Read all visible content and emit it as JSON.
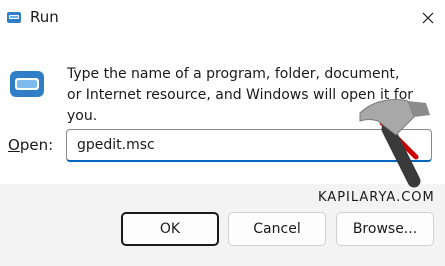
{
  "window": {
    "title": "Run",
    "icon": "run-app-icon",
    "close_icon": "close-icon"
  },
  "main": {
    "description": "Type the name of a program, folder, document, or Internet resource, and Windows will open it for you.",
    "open_label_mnemonic": "O",
    "open_label_rest": "pen:",
    "open_value": "gpedit.msc"
  },
  "buttons": {
    "ok": "OK",
    "cancel": "Cancel",
    "browse": "Browse..."
  },
  "watermark": {
    "text": "KAPILARYA.COM",
    "logo": "hammer-logo"
  },
  "colors": {
    "accent": "#0067c0",
    "footer_bg": "#f3f3f3",
    "hammer_head": "#a8a8a8",
    "hammer_handle": "#cc0000"
  }
}
